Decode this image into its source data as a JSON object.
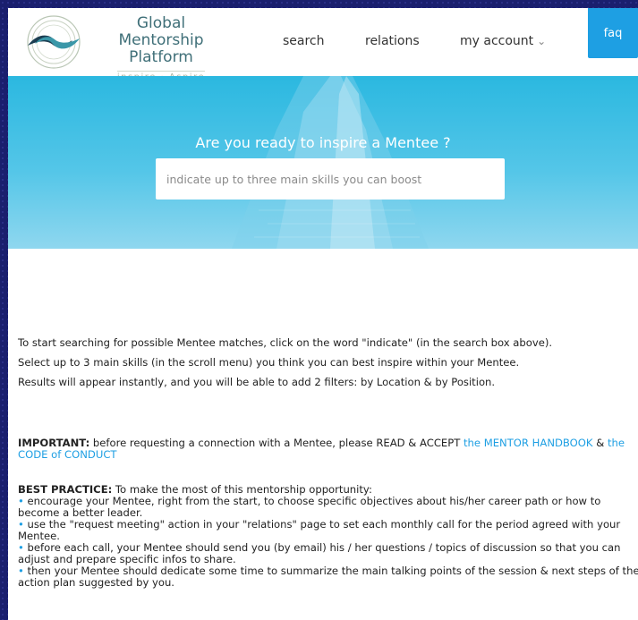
{
  "header": {
    "brand_line1": "Global Mentorship",
    "brand_line2": "Platform",
    "brand_tagline": "inspire · Aspire",
    "nav": {
      "search": "search",
      "relations": "relations",
      "my_account": "my account",
      "faq": "faq"
    },
    "chevron_icon": "chevron-down-icon"
  },
  "hero": {
    "title": "Are you ready to inspire a Mentee ?",
    "search_placeholder": "indicate up to three main skills you can boost"
  },
  "instructions": [
    "To start searching for possible Mentee matches, click on the word \"indicate\" (in the search box above).",
    "Select up to 3 main skills (in the scroll menu) you think you can best inspire within your Mentee.",
    "Results will appear instantly, and you will be able to add 2 filters: by Location & by Position."
  ],
  "important": {
    "label": "IMPORTANT:",
    "text": " before requesting a connection with a Mentee, please READ & ACCEPT ",
    "link1": "the MENTOR HANDBOOK",
    "and": " & ",
    "link2": "the CODE of CONDUCT"
  },
  "best_practice": {
    "label": "BEST PRACTICE:",
    "intro": " To make the most of this mentorship opportunity:",
    "items": [
      " encourage your Mentee, right from the start, to choose specific objectives about his/her career path or how to become a better leader.",
      " use the \"request meeting\" action in your \"relations\" page to set each monthly call for the period agreed with your Mentee.",
      " before each call, your Mentee should send you (by email) his / her questions / topics of discussion so that you can adjust and prepare specific infos to share.",
      " then your Mentee should dedicate some time to summarize the main talking points of the session & next steps of the action plan suggested by you."
    ]
  },
  "colors": {
    "accent": "#1e9fe3",
    "brand": "#3f6f78",
    "frame": "#1a1f6e"
  }
}
